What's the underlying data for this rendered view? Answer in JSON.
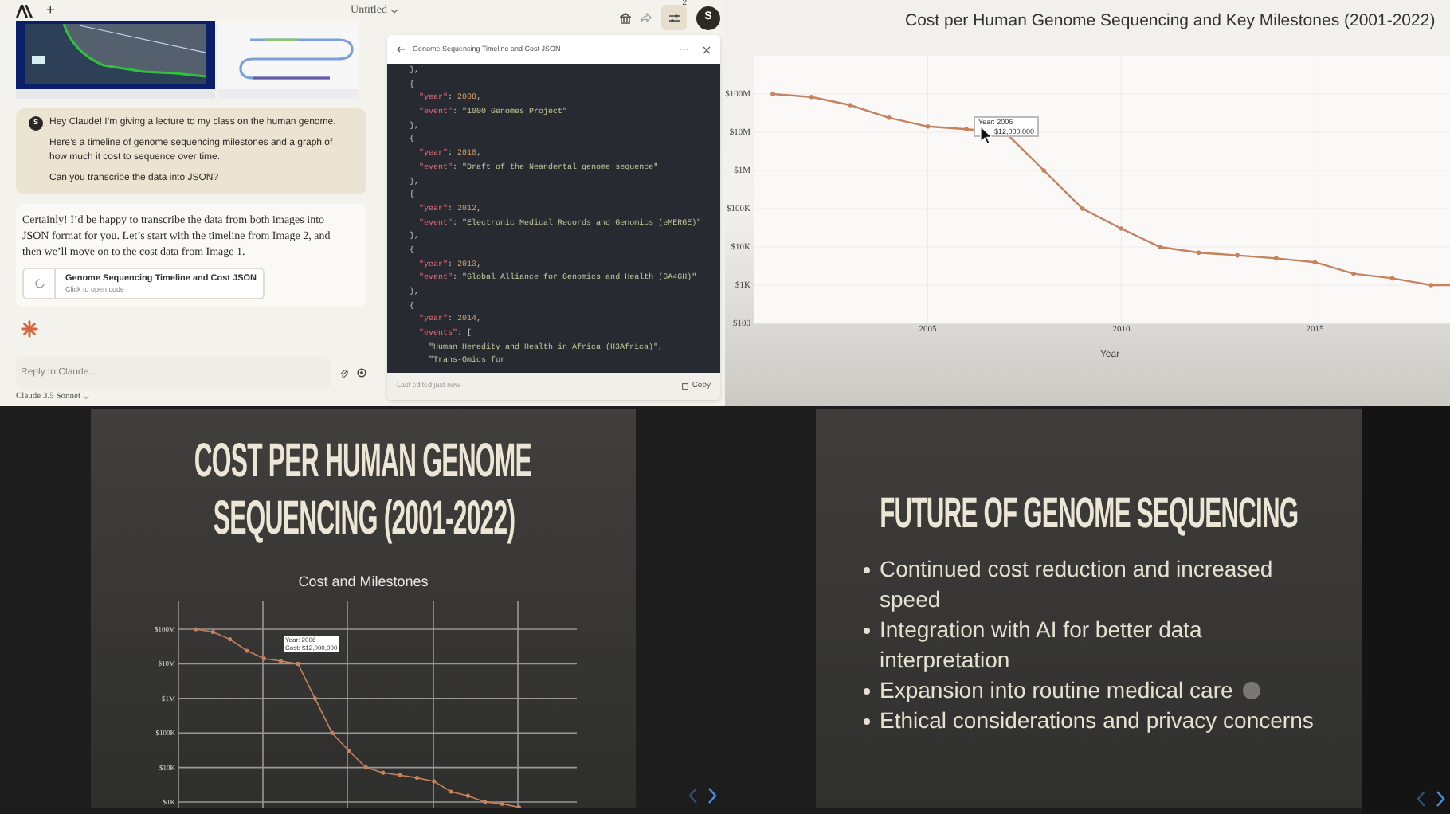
{
  "chat_panel": {
    "new_chat": "+",
    "document_title": "Untitled",
    "user_message": {
      "avatar": "S",
      "paragraphs": [
        "Hey Claude! I’m giving a lecture to my class on the human genome.",
        "Here’s a timeline of genome sequencing milestones and a graph of how much it cost to sequence over time.",
        "Can you transcribe the data into JSON?"
      ]
    },
    "assistant_message": {
      "paragraphs": [
        "Certainly! I’d be happy to transcribe the data from both images into JSON format for you. Let’s start with the timeline from Image 2, and then we’ll move on to the cost data from Image 1."
      ],
      "artifact": {
        "title": "Genome Sequencing Timeline and Cost JSON",
        "subtitle": "Click to open code"
      }
    },
    "composer": {
      "placeholder": "Reply to Claude...",
      "model": "Claude 3.5 Sonnet"
    }
  },
  "toolbar": {
    "badge": "2",
    "avatar": "S"
  },
  "artifact_panel": {
    "title": "Genome Sequencing Timeline and Cost JSON",
    "code_lines": [
      "  },",
      "  {",
      "    \"year\": 2008,",
      "    \"event\": \"1000 Genomes Project\"",
      "  },",
      "  {",
      "    \"year\": 2010,",
      "    \"event\": \"Draft of the Neandertal genome sequence\"",
      "  },",
      "  {",
      "    \"year\": 2012,",
      "    \"event\": \"Electronic Medical Records and Genomics (eMERGE)\"",
      "  },",
      "  {",
      "    \"year\": 2013,",
      "    \"event\": \"Global Alliance for Genomics and Health (GA4GH)\"",
      "  },",
      "  {",
      "    \"year\": 2014,",
      "    \"events\": [",
      "      \"Human Heredity and Health in Africa (H3Africa)\",",
      "      \"Trans-Omics for"
    ],
    "footer": "Last edited just now",
    "copy_label": "Copy"
  },
  "chart_window": {
    "title": "Cost per Human Genome Sequencing and Key Milestones (2001-2022)",
    "y_axis_labels": [
      "$100M",
      "$10M",
      "$1M",
      "$100K",
      "$10K",
      "$1K",
      "$100"
    ],
    "x_axis_labels": [
      "2005",
      "2010",
      "2015"
    ],
    "x_axis_title": "Year",
    "tooltip": [
      "Year: 2006",
      "$12,000,000"
    ]
  },
  "slide_1": {
    "title_lines": [
      "COST PER HUMAN GENOME",
      "SEQUENCING (2001-2022)"
    ],
    "chart_title": "Cost and Milestones",
    "y_axis_labels": [
      "$100M",
      "$10M",
      "$1M",
      "$100K",
      "$10K",
      "$1K"
    ],
    "tooltip": [
      "Year: 2006",
      "Cost: $12,000,000"
    ]
  },
  "slide_2": {
    "title": "FUTURE OF GENOME SEQUENCING",
    "bullets": [
      "Continued cost reduction and increased speed",
      "Integration with AI for better data interpretation",
      "Expansion into routine medical care",
      "Ethical considerations and privacy concerns"
    ]
  }
}
